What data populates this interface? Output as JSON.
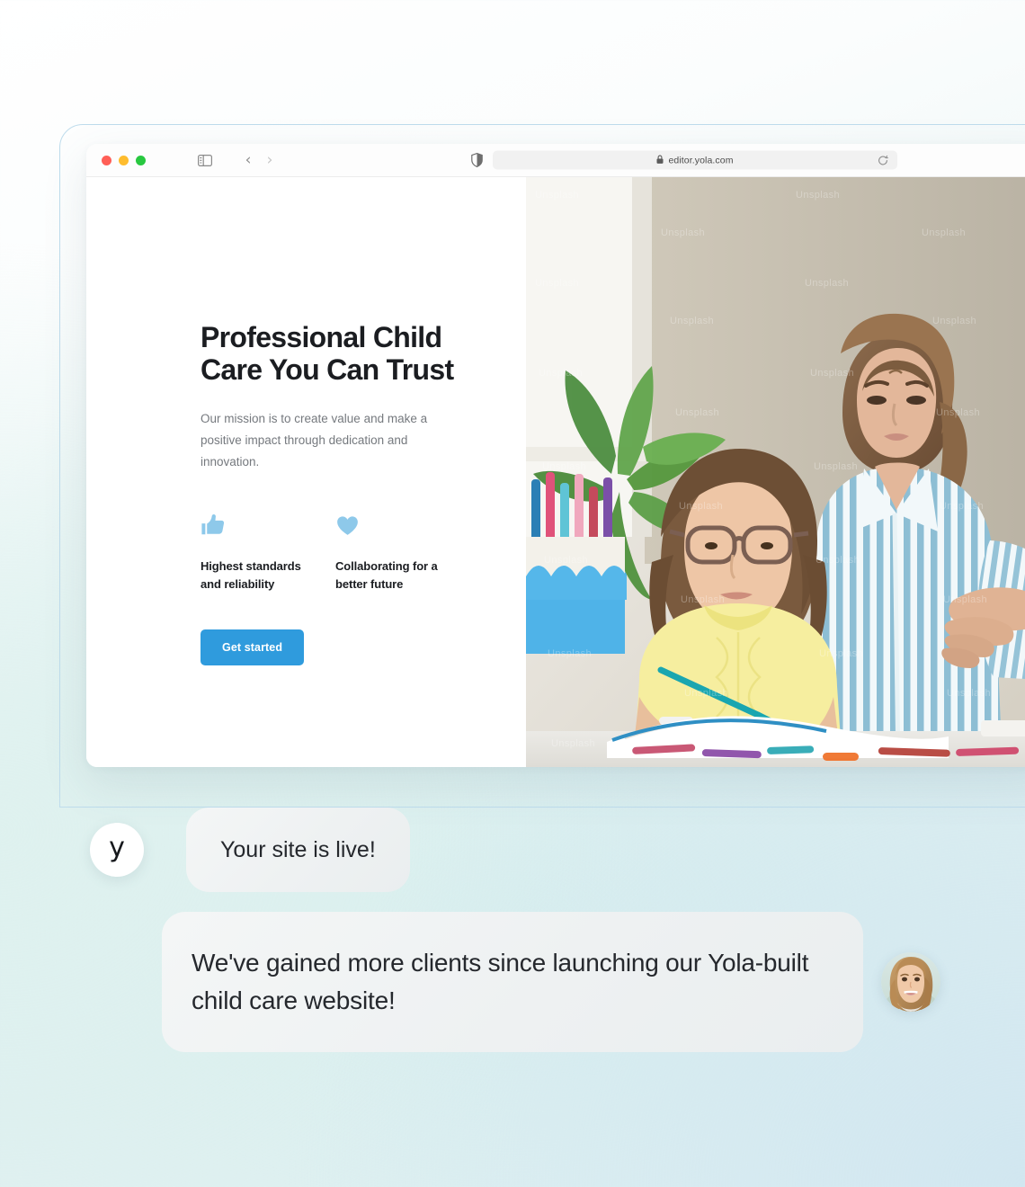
{
  "browser": {
    "traffic_lights": [
      "close",
      "minimize",
      "maximize"
    ],
    "sidebar_icon": "sidebar-toggle-icon",
    "back_label": "‹",
    "forward_label": "›",
    "shield_icon": "privacy-shield-icon",
    "lock_icon": "lock-icon",
    "url": "editor.yola.com",
    "reload_icon": "reload-icon"
  },
  "site": {
    "headline": "Professional Child Care You Can Trust",
    "subtext": "Our mission is to create value and make a positive impact through dedication and innovation.",
    "features": [
      {
        "icon": "thumbs-up-icon",
        "label": "Highest standards and reliability"
      },
      {
        "icon": "heart-icon",
        "label": "Collaborating for a better future"
      }
    ],
    "cta_label": "Get started",
    "photo_alt": "woman-helping-girl-with-homework",
    "watermark_text": "Unsplash"
  },
  "chat": {
    "brand_mark": "y",
    "message_1": "Your site is live!",
    "message_2": "We've gained more clients since launching our Yola-built child care website!",
    "client_avatar": "client-photo-avatar"
  },
  "colors": {
    "accent": "#2f9bdd",
    "feature_icon": "#8ec9ea",
    "heading": "#1b1d21",
    "body_text": "#75797e",
    "frame_border": "#bedcec"
  }
}
